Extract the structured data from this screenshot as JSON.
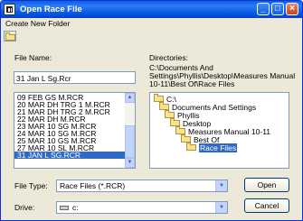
{
  "window": {
    "title": "Open Race File"
  },
  "titlebar_buttons": {
    "minimize": "_",
    "maximize": "□",
    "close": "×"
  },
  "menu": {
    "create_new_folder": "Create New Folder"
  },
  "file_name": {
    "label": "File Name:",
    "value": "31 Jan L Sg.Rcr"
  },
  "files": [
    "09 FEB GS M.RCR",
    "20 MAR DH TRG 1 M.RCR",
    "21 MAR DH TRG 2 M.RCR",
    "22 MAR DH M.RCR",
    "23 MAR 10 SG M.RCR",
    "24 MAR 10 SG M.RCR",
    "25 MAR 10 GS M.RCR",
    "27 MAR 10 SL M.RCR",
    "31 JAN L SG.RCR"
  ],
  "selected_file_index": 8,
  "directories": {
    "label": "Directories:",
    "path_line1": "C:\\Documents And",
    "path_line2": "Settings\\Phyllis\\Desktop\\Measures Manual",
    "path_line3": "10-11\\Best Of\\Race Files",
    "tree": [
      "C:\\",
      "Documents And Settings",
      "Phyllis",
      "Desktop",
      "Measures Manual 10-11",
      "Best Of",
      "Race Files"
    ]
  },
  "file_type": {
    "label": "File Type:",
    "value": "Race Files (*.RCR)"
  },
  "drive": {
    "label": "Drive:",
    "value": "c:"
  },
  "buttons": {
    "open": "Open",
    "cancel": "Cancel"
  },
  "colors": {
    "selection": "#316ac5",
    "titlebar": "#0554e3",
    "dialog_bg": "#ece9d8"
  }
}
